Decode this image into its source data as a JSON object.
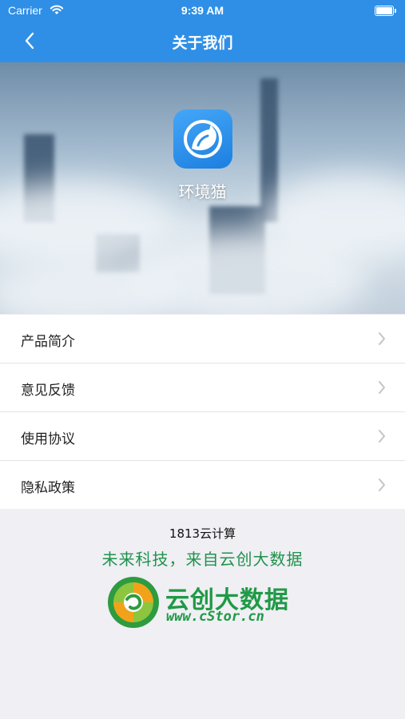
{
  "status_bar": {
    "carrier": "Carrier",
    "time": "9:39 AM"
  },
  "nav": {
    "title": "关于我们",
    "back_icon": "chevron-left-icon"
  },
  "app": {
    "name": "环境猫",
    "icon": "cat-logo-icon"
  },
  "menu": {
    "items": [
      {
        "label": "产品简介"
      },
      {
        "label": "意见反馈"
      },
      {
        "label": "使用协议"
      },
      {
        "label": "隐私政策"
      }
    ]
  },
  "footer": {
    "company": "1813云计算",
    "slogan": "未来科技，来自云创大数据",
    "logo_title": "云创大数据",
    "logo_url": "www.cStor.cn"
  },
  "colors": {
    "header": "#2f8fe6",
    "brand_green": "#1f9a45"
  }
}
